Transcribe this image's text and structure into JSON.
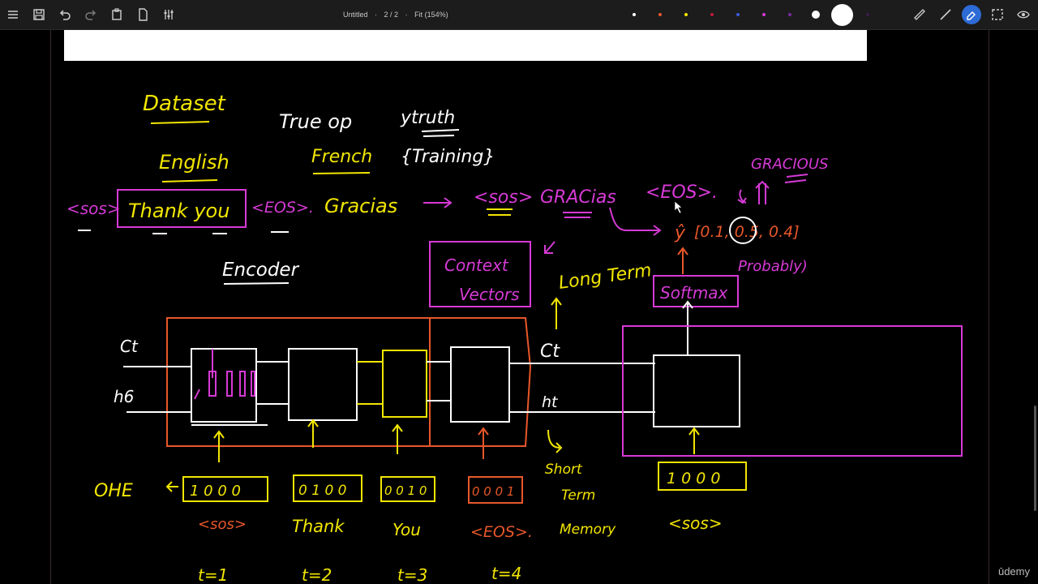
{
  "toolbar": {
    "doc_title": "Untitled",
    "sep1": "·",
    "page_indicator": "2 / 2",
    "sep2": "·",
    "zoom": "Fit (154%)"
  },
  "palette": [
    "#ffffff",
    "#e8572a",
    "#f2e600",
    "#c6173a",
    "#3b5bdb",
    "#d63ad6",
    "#7a2aa0"
  ],
  "canvas_text": {
    "dataset": "Dataset",
    "english": "English",
    "true_op": "True op",
    "ytruth": "ytruth",
    "french": "French",
    "training": "{Training}",
    "sos1": "<sos>",
    "thank_you": "Thank you",
    "eos1": "<EOS>.",
    "gracias1": "Gracias",
    "sos2": "<sos>",
    "gracias2": "GRACias",
    "eos2": "<EOS>.",
    "gracious": "GRACIOUS",
    "yhat": "ŷ",
    "probs": "[0.1, 0.5, 0.4]",
    "probably": "Probably)",
    "encoder": "Encoder",
    "context1": "Context",
    "context2": "Vectors",
    "long_term": "Long Term",
    "softmax": "Softmax",
    "ct_left": "Ct",
    "ht_left": "h6",
    "ct_mid": "Ct",
    "ht_mid": "ht",
    "short1": "Short",
    "short2": "Term",
    "short3": "Memory",
    "ohe": "OHE",
    "v1": "1 0 0 0",
    "v2": "0 1 0 0",
    "v3": "0 0 1 0",
    "v4": "0 0 0 1",
    "v5": "1 0 0 0",
    "tok1": "<sos>",
    "tok2": "Thank",
    "tok3": "You",
    "tok4": "<EOS>.",
    "tok5": "<sos>",
    "t1": "t=1",
    "t2": "t=2",
    "t3": "t=3",
    "t4": "t=4"
  },
  "watermark": "ūdemy"
}
